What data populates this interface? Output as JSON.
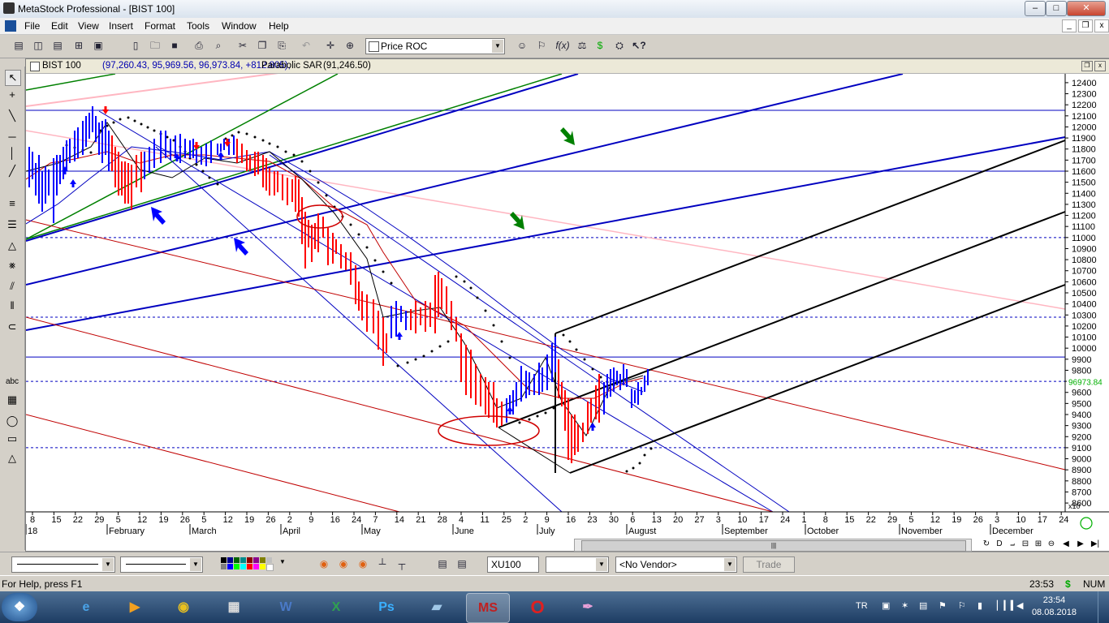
{
  "window": {
    "title": "MetaStock Professional - [BIST 100]",
    "minimize": "–",
    "maximize": "□",
    "close": "✕"
  },
  "menu": {
    "items": [
      "File",
      "Edit",
      "View",
      "Insert",
      "Format",
      "Tools",
      "Window",
      "Help"
    ],
    "mdi_min": "_",
    "mdi_restore": "❐",
    "mdi_close": "x"
  },
  "toolbar": {
    "indicator": "Price ROC"
  },
  "chart": {
    "header_name": "BIST 100",
    "header_values": "(97,260.43, 95,969.56, 96,973.84, +812.805),",
    "header_indicator": "Parabolic SAR",
    "header_indicator_value": "(91,246.50)",
    "last_price_label": "96973.84",
    "y_unit": "x10"
  },
  "chart_data": {
    "type": "bar",
    "title": "BIST 100",
    "y_ticks": [
      8600,
      8700,
      8800,
      8900,
      9000,
      9100,
      9200,
      9300,
      9400,
      9500,
      9600,
      9700,
      9800,
      9900,
      10000,
      10100,
      10200,
      10300,
      10400,
      10500,
      10600,
      10700,
      10800,
      10900,
      11000,
      11100,
      11200,
      11300,
      11400,
      11500,
      11600,
      11700,
      11800,
      11900,
      12000,
      12100,
      12200,
      12300,
      12400
    ],
    "ylim": [
      8520,
      12480
    ],
    "x_day_ticks": [
      "8",
      "15",
      "22",
      "29",
      "5",
      "12",
      "19",
      "26",
      "5",
      "12",
      "19",
      "26",
      "2",
      "9",
      "16",
      "24",
      "7",
      "14",
      "21",
      "28",
      "4",
      "11",
      "25",
      "2",
      "9",
      "16",
      "23",
      "30",
      "6",
      "13",
      "20",
      "27",
      "3",
      "10",
      "17",
      "24",
      "1",
      "8",
      "15",
      "22",
      "29",
      "5",
      "12",
      "19",
      "26",
      "3",
      "10",
      "17",
      "24"
    ],
    "x_month_labels": [
      "18",
      "February",
      "March",
      "April",
      "May",
      "June",
      "July",
      "August",
      "September",
      "October",
      "November",
      "December"
    ],
    "horizontal_levels": [
      12150,
      11600,
      9920
    ],
    "dashed_levels": [
      11000,
      10280,
      9700,
      9100
    ],
    "last_value": 9697.384
  },
  "bottom": {
    "symbol": "XU100",
    "vendor": "<No Vendor>",
    "trade": "Trade"
  },
  "status": {
    "help": "For Help, press F1",
    "time": "23:53",
    "num": "NUM"
  },
  "taskbar": {
    "lang": "TR",
    "clock_time": "23:54",
    "clock_date": "08.08.2018"
  }
}
